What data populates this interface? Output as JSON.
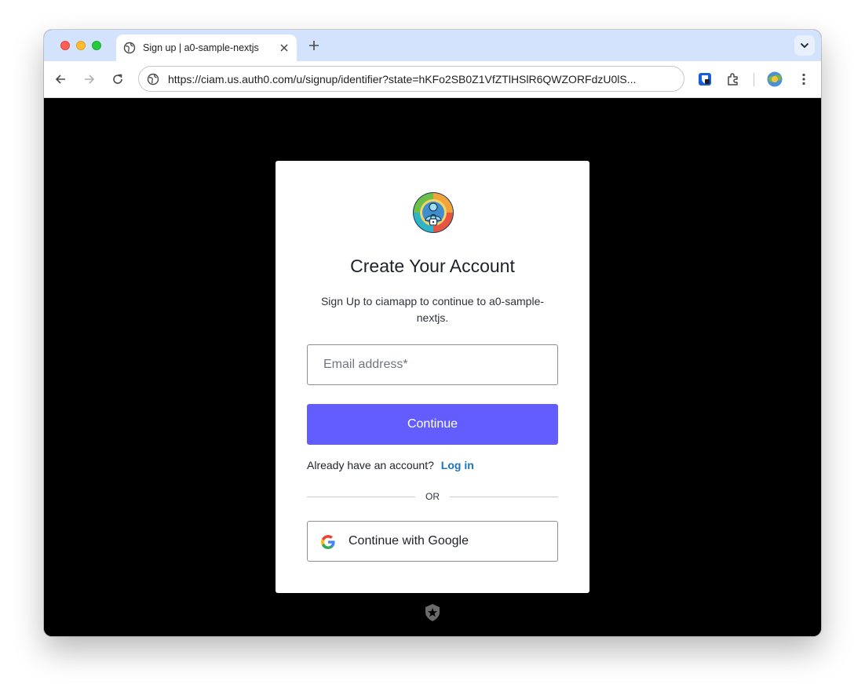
{
  "browser": {
    "tab_title": "Sign up | a0-sample-nextjs",
    "url": "https://ciam.us.auth0.com/u/signup/identifier?state=hKFo2SB0Z1VfZTlHSlR6QWZORFdzU0lS...",
    "icons": [
      "globe-icon",
      "close-icon",
      "plus-icon",
      "chevron-down-icon",
      "back-arrow-icon",
      "forward-arrow-icon",
      "reload-icon",
      "site-info-icon",
      "bitwarden-icon",
      "extensions-icon",
      "profile-avatar-icon",
      "kebab-menu-icon"
    ]
  },
  "signup": {
    "title": "Create Your Account",
    "subtitle": "Sign Up to ciamapp to continue to a0-sample-nextjs.",
    "email_placeholder": "Email address*",
    "continue_label": "Continue",
    "already_text": "Already have an account?",
    "login_label": "Log in",
    "divider_text": "OR",
    "google_label": "Continue with Google"
  },
  "colors": {
    "primary": "#635dff",
    "link": "#1b75bb",
    "tab_strip": "#d3e3fd",
    "page_bg": "#000000"
  }
}
